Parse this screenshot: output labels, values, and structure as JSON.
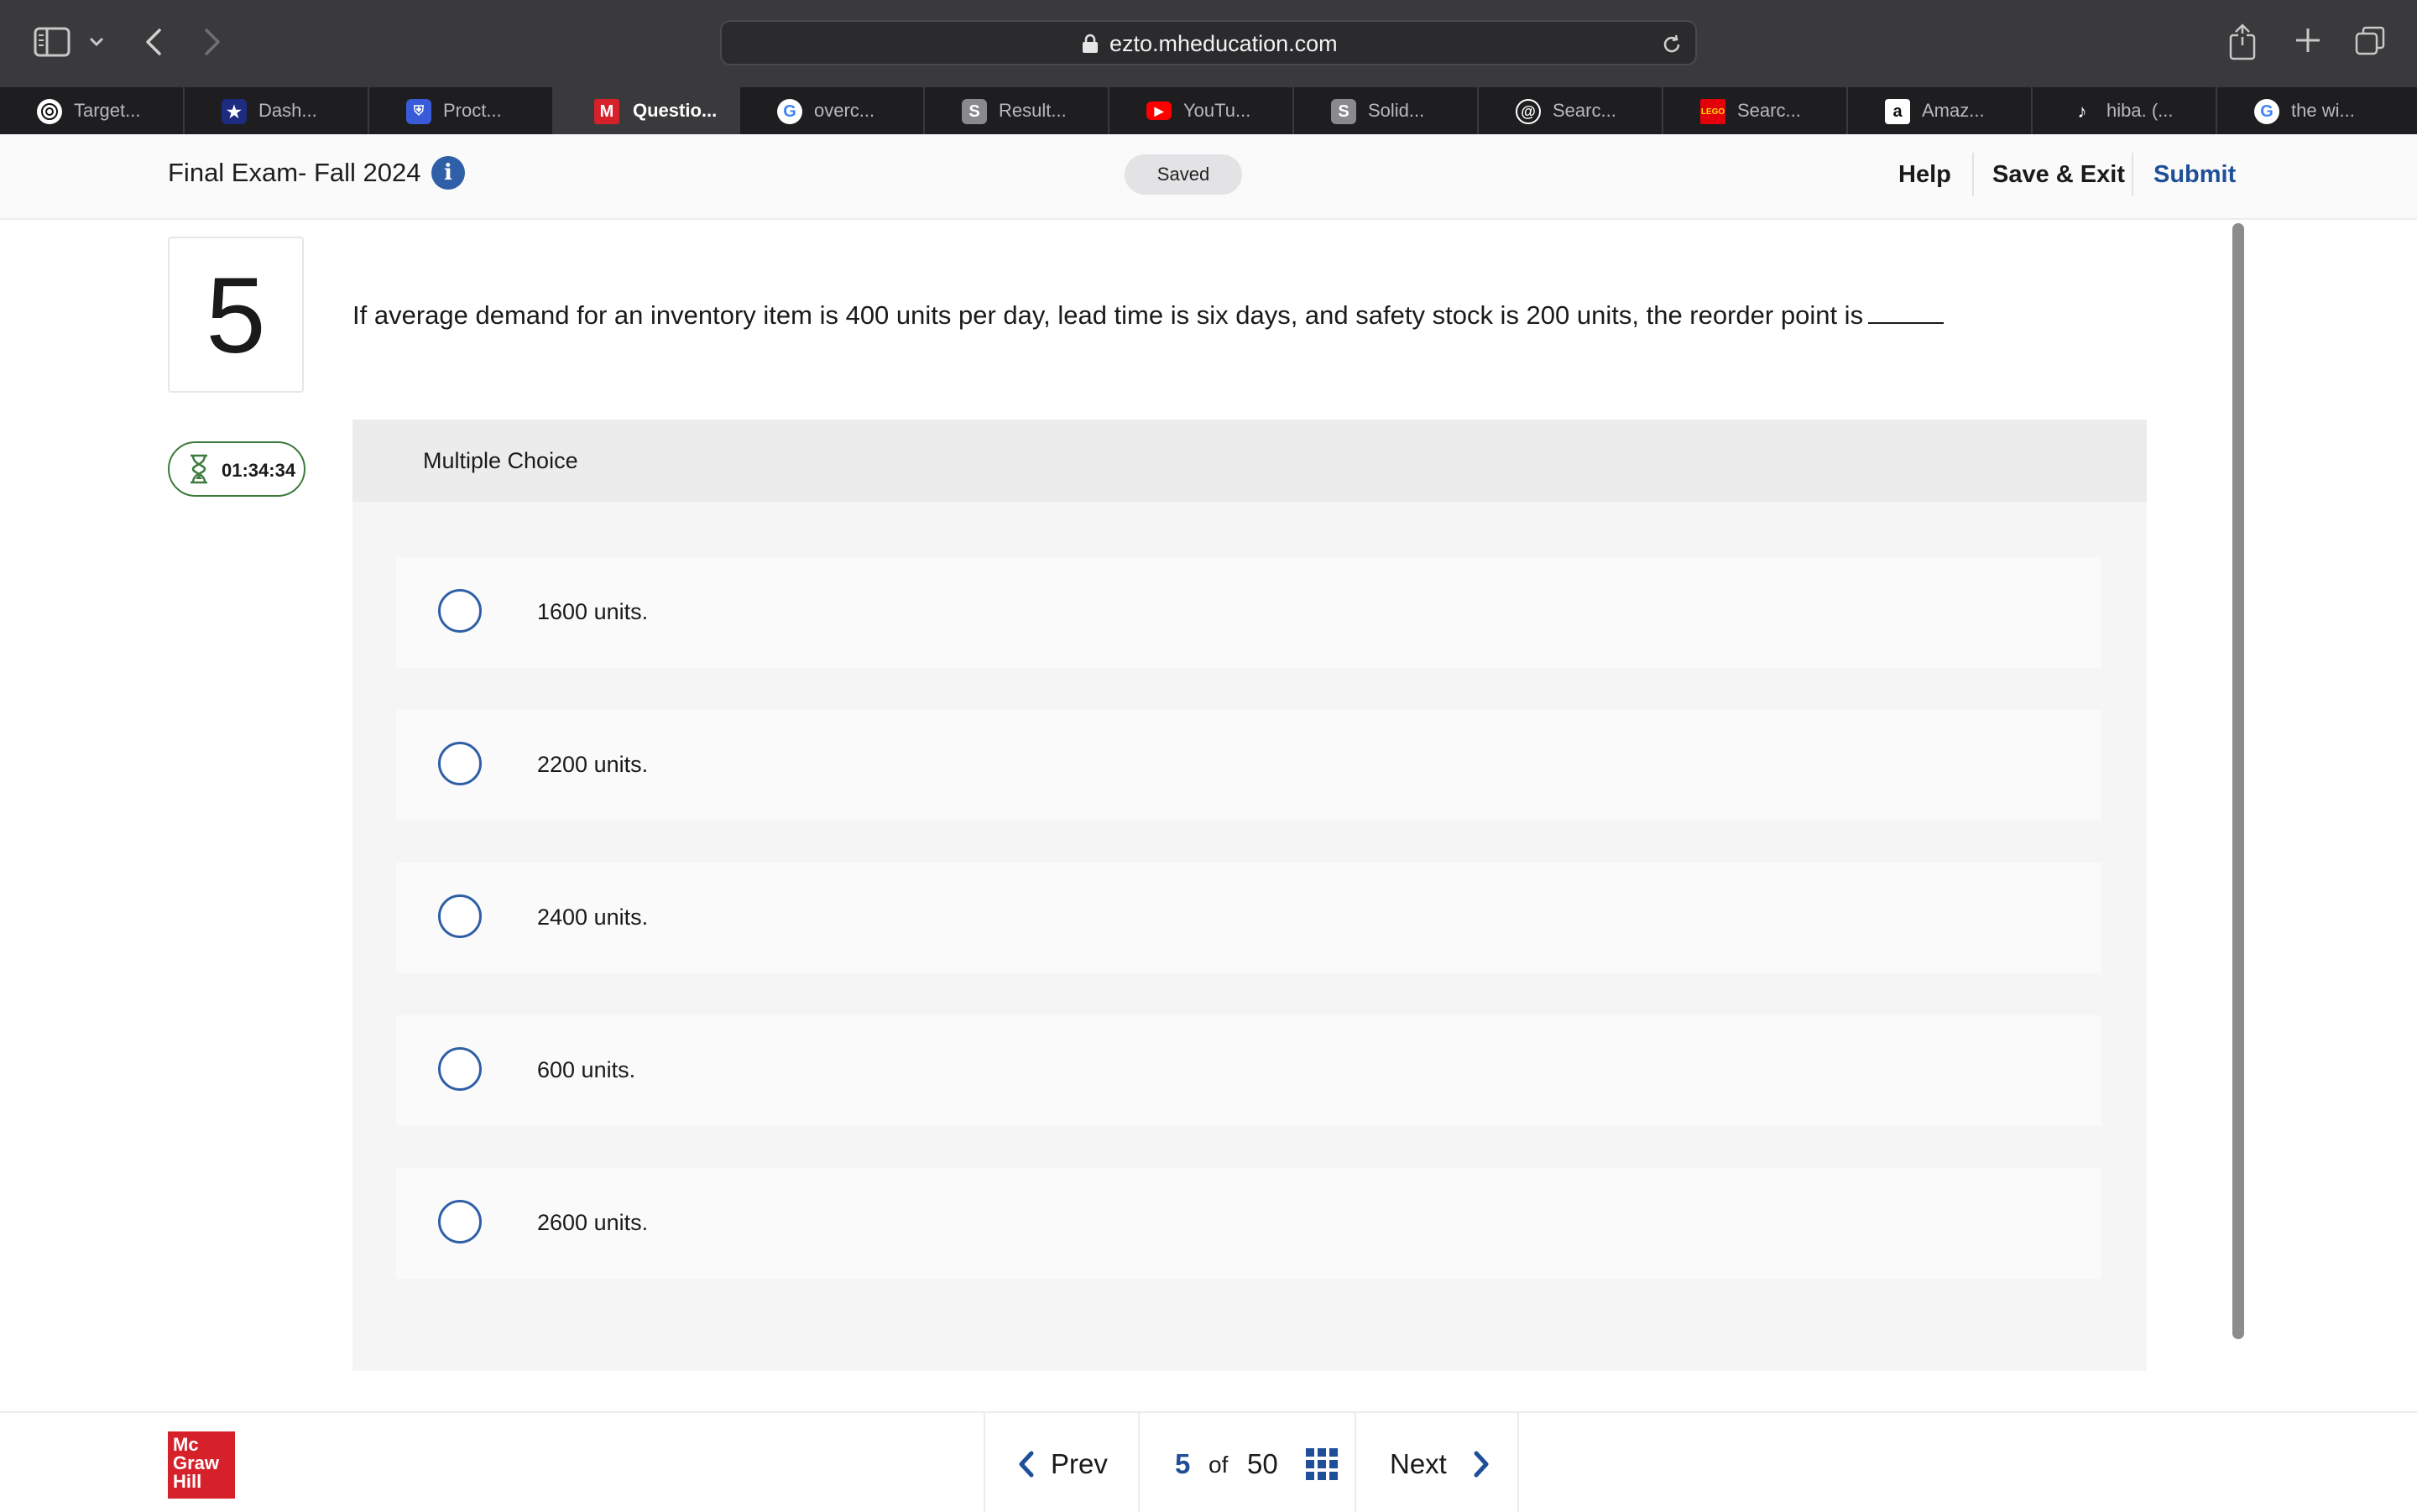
{
  "browser": {
    "url": "ezto.mheducation.com",
    "tabs": [
      {
        "label": "Target...",
        "icon": "chatgpt-icon",
        "active": false
      },
      {
        "label": "Dash...",
        "icon": "star-shield-icon",
        "active": false
      },
      {
        "label": "Proct...",
        "icon": "proctor-shield-icon",
        "active": false
      },
      {
        "label": "Questio...",
        "icon": "mheducation-m-icon",
        "active": true
      },
      {
        "label": "overc...",
        "icon": "google-icon",
        "active": false
      },
      {
        "label": "Result...",
        "icon": "s-icon",
        "active": false
      },
      {
        "label": "YouTu...",
        "icon": "youtube-icon",
        "active": false
      },
      {
        "label": "Solid...",
        "icon": "s-icon",
        "active": false
      },
      {
        "label": "Searc...",
        "icon": "at-sign-icon",
        "active": false
      },
      {
        "label": "Searc...",
        "icon": "lego-icon",
        "active": false
      },
      {
        "label": "Amaz...",
        "icon": "amazon-icon",
        "active": false
      },
      {
        "label": "hiba. (...",
        "icon": "tiktok-icon",
        "active": false
      },
      {
        "label": "the wi...",
        "icon": "google-icon",
        "active": false
      }
    ]
  },
  "header": {
    "exam_title": "Final Exam- Fall 2024",
    "saved_label": "Saved",
    "help_label": "Help",
    "save_exit_label": "Save & Exit",
    "submit_label": "Submit"
  },
  "question": {
    "number": "5",
    "timer": "01:34:34",
    "text": "If average demand for an inventory item is 400 units per day, lead time is six days, and safety stock is 200 units, the reorder point is",
    "type_label": "Multiple Choice",
    "options": [
      {
        "label": "1600 units."
      },
      {
        "label": "2200 units."
      },
      {
        "label": "2400 units."
      },
      {
        "label": "600 units."
      },
      {
        "label": "2600 units."
      }
    ]
  },
  "footer": {
    "logo_lines": [
      "Mc",
      "Graw",
      "Hill"
    ],
    "prev_label": "Prev",
    "current_page": "5",
    "of_label": "of",
    "total_pages": "50",
    "next_label": "Next"
  },
  "colors": {
    "accent": "#1f4f99",
    "radio_border": "#2f5fa7",
    "timer_border": "#3d7a3d",
    "logo_red": "#d6212a"
  }
}
